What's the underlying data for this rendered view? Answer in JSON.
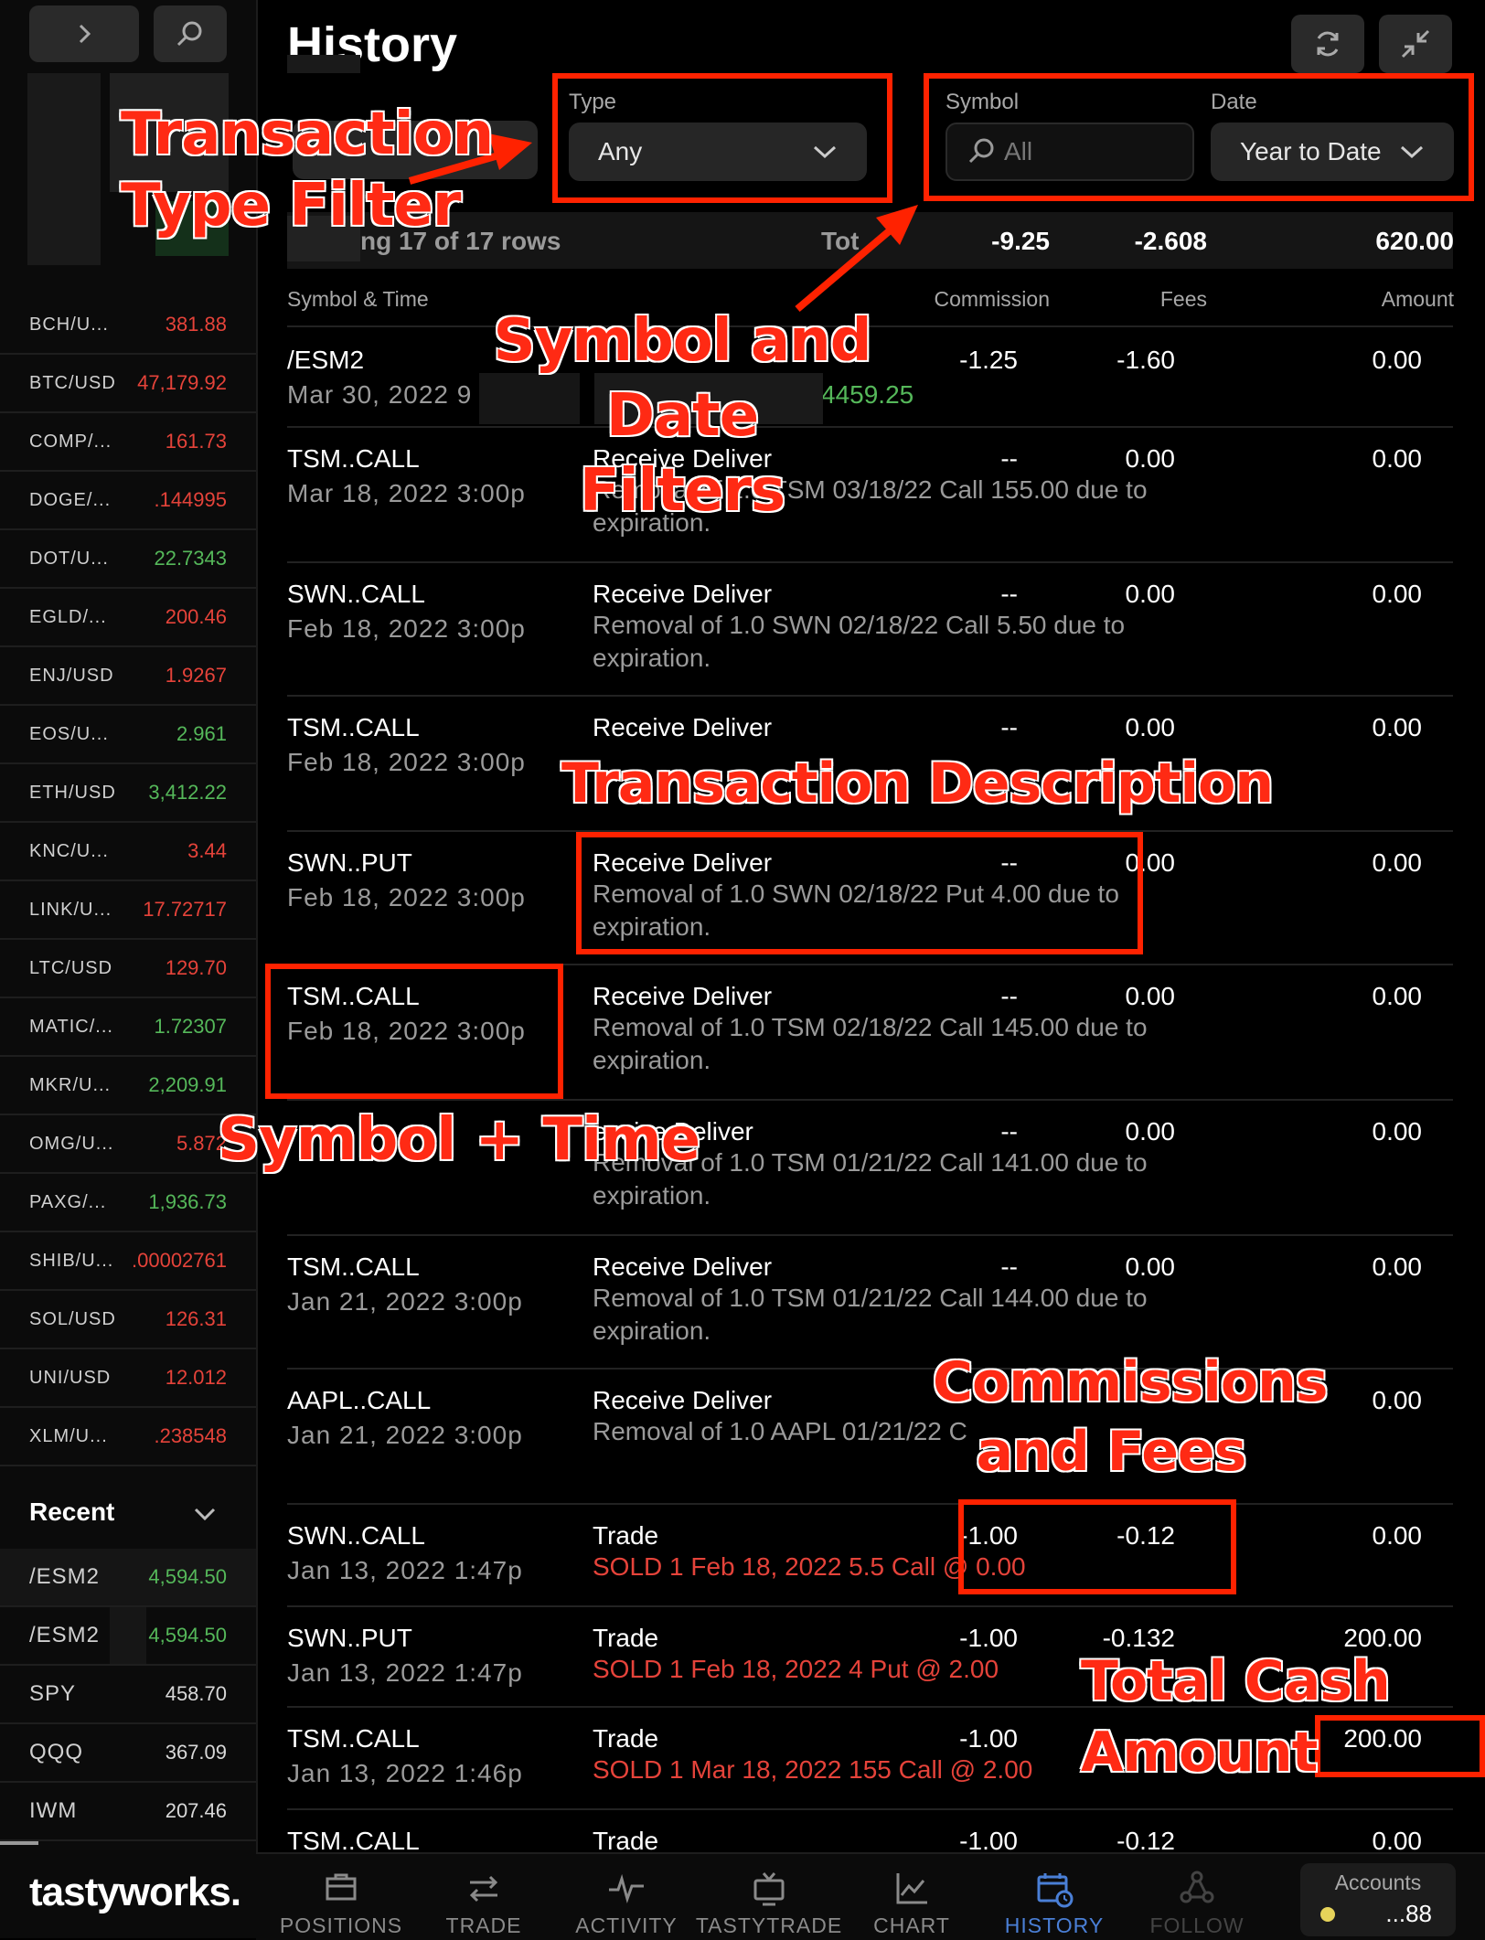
{
  "page": {
    "title": "History"
  },
  "filters": {
    "type_label": "Type",
    "type_value": "Any",
    "symbol_label": "Symbol",
    "symbol_placeholder": "All",
    "date_label": "Date",
    "date_value": "Year to Date"
  },
  "summary": {
    "rows_text": "ng 17 of 17 rows",
    "total_label": "Tot",
    "commission": "-9.25",
    "fees": "-2.608",
    "amount": "620.00"
  },
  "columns": {
    "symbol_time": "Symbol & Time",
    "commission": "Commission",
    "fees": "Fees",
    "amount": "Amount"
  },
  "rows": [
    {
      "symbol": "/ESM2",
      "time": "Mar 30, 2022  9",
      "type": "",
      "desc": "4459.25",
      "commission": "-1.25",
      "fees": "-1.60",
      "amount": "0.00"
    },
    {
      "symbol": "TSM..CALL",
      "time": "Mar 18, 2022  3:00p",
      "type": "Receive Deliver",
      "desc": "Removal of 1.0 TSM 03/18/22 Call 155.00 due to expiration.",
      "commission": "--",
      "fees": "0.00",
      "amount": "0.00"
    },
    {
      "symbol": "SWN..CALL",
      "time": "Feb 18, 2022  3:00p",
      "type": "Receive Deliver",
      "desc": "Removal of 1.0 SWN 02/18/22 Call 5.50 due to expiration.",
      "commission": "--",
      "fees": "0.00",
      "amount": "0.00"
    },
    {
      "symbol": "TSM..CALL",
      "time": "Feb 18, 2022  3:00p",
      "type": "Receive Deliver",
      "desc": "",
      "commission": "--",
      "fees": "0.00",
      "amount": "0.00"
    },
    {
      "symbol": "SWN..PUT",
      "time": "Feb 18, 2022  3:00p",
      "type": "Receive Deliver",
      "desc": "Removal of 1.0 SWN 02/18/22 Put 4.00 due to expiration.",
      "commission": "--",
      "fees": "0.00",
      "amount": "0.00"
    },
    {
      "symbol": "TSM..CALL",
      "time": "Feb 18, 2022  3:00p",
      "type": "Receive Deliver",
      "desc": "Removal of 1.0 TSM 02/18/22 Call 145.00 due to expiration.",
      "commission": "--",
      "fees": "0.00",
      "amount": "0.00"
    },
    {
      "symbol": "",
      "time": "",
      "type": "eceive Deliver",
      "desc": "Removal of 1.0 TSM 01/21/22 Call 141.00 due to expiration.",
      "commission": "--",
      "fees": "0.00",
      "amount": "0.00"
    },
    {
      "symbol": "TSM..CALL",
      "time": "Jan 21, 2022  3:00p",
      "type": "Receive Deliver",
      "desc": "Removal of 1.0 TSM 01/21/22 Call 144.00 due to expiration.",
      "commission": "--",
      "fees": "0.00",
      "amount": "0.00"
    },
    {
      "symbol": "AAPL..CALL",
      "time": "Jan 21, 2022  3:00p",
      "type": "Receive Deliver",
      "desc": "Removal of 1.0 AAPL 01/21/22 C",
      "commission": "",
      "fees": "",
      "amount": "0.00"
    },
    {
      "symbol": "SWN..CALL",
      "time": "Jan 13, 2022  1:47p",
      "type": "Trade",
      "desc": "SOLD 1 Feb 18, 2022 5.5 Call @ 0.00",
      "commission": "-1.00",
      "fees": "-0.12",
      "amount": "0.00"
    },
    {
      "symbol": "SWN..PUT",
      "time": "Jan 13, 2022  1:47p",
      "type": "Trade",
      "desc": "SOLD 1 Feb 18, 2022 4 Put @ 2.00",
      "commission": "-1.00",
      "fees": "-0.132",
      "amount": "200.00"
    },
    {
      "symbol": "TSM..CALL",
      "time": "Jan 13, 2022  1:46p",
      "type": "Trade",
      "desc": "SOLD 1 Mar 18, 2022 155 Call @ 2.00",
      "commission": "-1.00",
      "fees": "",
      "amount": "200.00"
    },
    {
      "symbol": "TSM..CALL",
      "time": "",
      "type": "Trade",
      "desc": "",
      "commission": "-1.00",
      "fees": "-0.12",
      "amount": "0.00"
    }
  ],
  "watchlist": [
    {
      "symbol": "BCH/U...",
      "value": "381.88",
      "color": "#e5433a"
    },
    {
      "symbol": "BTC/USD",
      "value": "47,179.92",
      "color": "#e5433a"
    },
    {
      "symbol": "COMP/...",
      "value": "161.73",
      "color": "#e5433a"
    },
    {
      "symbol": "DOGE/...",
      "value": ".144995",
      "color": "#e5433a"
    },
    {
      "symbol": "DOT/U...",
      "value": "22.7343",
      "color": "#55b85a"
    },
    {
      "symbol": "EGLD/...",
      "value": "200.46",
      "color": "#e5433a"
    },
    {
      "symbol": "ENJ/USD",
      "value": "1.9267",
      "color": "#e5433a"
    },
    {
      "symbol": "EOS/U...",
      "value": "2.961",
      "color": "#55b85a"
    },
    {
      "symbol": "ETH/USD",
      "value": "3,412.22",
      "color": "#55b85a"
    },
    {
      "symbol": "KNC/U...",
      "value": "3.44",
      "color": "#e5433a"
    },
    {
      "symbol": "LINK/U...",
      "value": "17.72717",
      "color": "#e5433a"
    },
    {
      "symbol": "LTC/USD",
      "value": "129.70",
      "color": "#e5433a"
    },
    {
      "symbol": "MATIC/...",
      "value": "1.72307",
      "color": "#55b85a"
    },
    {
      "symbol": "MKR/U...",
      "value": "2,209.91",
      "color": "#55b85a"
    },
    {
      "symbol": "OMG/U...",
      "value": "5.872",
      "color": "#e5433a"
    },
    {
      "symbol": "PAXG/...",
      "value": "1,936.73",
      "color": "#55b85a"
    },
    {
      "symbol": "SHIB/U...",
      "value": ".00002761",
      "color": "#e5433a"
    },
    {
      "symbol": "SOL/USD",
      "value": "126.31",
      "color": "#e5433a"
    },
    {
      "symbol": "UNI/USD",
      "value": "12.012",
      "color": "#e5433a"
    },
    {
      "symbol": "XLM/U...",
      "value": ".238548",
      "color": "#e5433a"
    }
  ],
  "recent": {
    "label": "Recent",
    "items": [
      {
        "symbol": "/ESM2",
        "value": "4,594.50",
        "color": "#55b85a"
      },
      {
        "symbol": "/ESM2",
        "value": "4,594.50",
        "color": "#55b85a"
      },
      {
        "symbol": "SPY",
        "value": "458.70",
        "color": "#d8d8d8"
      },
      {
        "symbol": "QQQ",
        "value": "367.09",
        "color": "#d8d8d8"
      },
      {
        "symbol": "IWM",
        "value": "207.46",
        "color": "#d8d8d8"
      }
    ]
  },
  "brand": "tastyworks.",
  "nav": {
    "items": [
      "POSITIONS",
      "TRADE",
      "ACTIVITY",
      "TASTYTRADE",
      "CHART",
      "HISTORY",
      "FOLLOW"
    ],
    "active": "HISTORY",
    "accounts_label": "Accounts",
    "accounts_value": "...88"
  },
  "annotations": {
    "type_filter": [
      "Transaction",
      "Type Filter"
    ],
    "symbol_date": [
      "Symbol and Date",
      "Filters"
    ],
    "description": "Transaction Description",
    "symbol_time": "Symbol + Time",
    "commissions": [
      "Commissions",
      "and Fees"
    ],
    "total_cash": [
      "Total Cash",
      "Amount"
    ]
  },
  "colors": {
    "accent": "#4a7fd6",
    "annotation": "#ff2200",
    "negative": "#e5433a",
    "positive": "#55b85a"
  }
}
